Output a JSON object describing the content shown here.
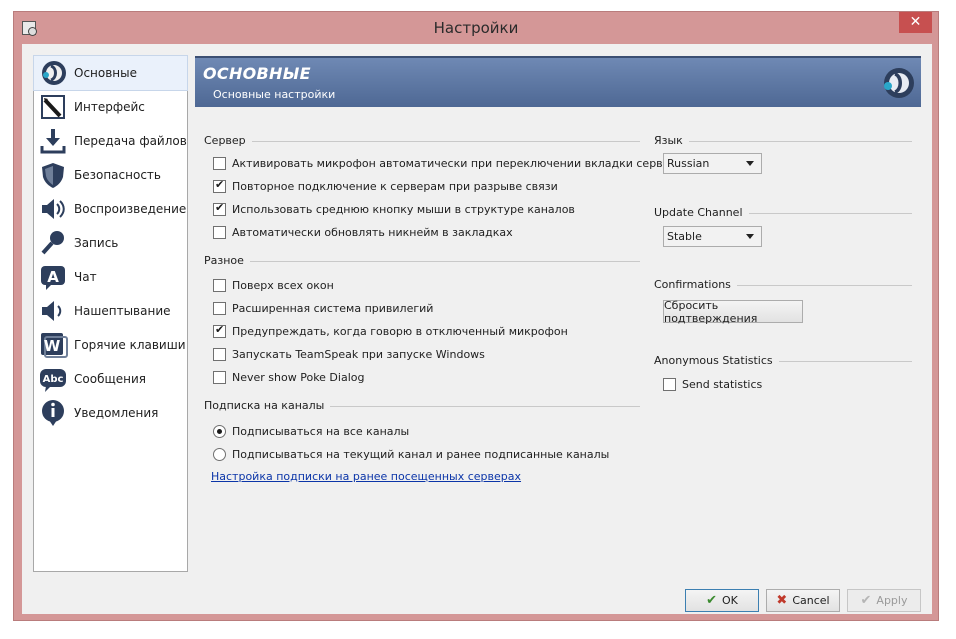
{
  "window": {
    "title": "Настройки",
    "close_glyph": "✕",
    "accent": "#d49797"
  },
  "sidebar": {
    "items": [
      {
        "label": "Основные",
        "icon": "teamspeak-logo-icon",
        "selected": true
      },
      {
        "label": "Интерфейс",
        "icon": "pen-icon"
      },
      {
        "label": "Передача файлов",
        "icon": "download-icon"
      },
      {
        "label": "Безопасность",
        "icon": "shield-icon"
      },
      {
        "label": "Воспроизведение",
        "icon": "speaker-icon"
      },
      {
        "label": "Запись",
        "icon": "microphone-icon"
      },
      {
        "label": "Чат",
        "icon": "chat-icon"
      },
      {
        "label": "Нашептывание",
        "icon": "whisper-icon"
      },
      {
        "label": "Горячие клавиши",
        "icon": "hotkey-icon"
      },
      {
        "label": "Сообщения",
        "icon": "messages-icon"
      },
      {
        "label": "Уведомления",
        "icon": "notification-icon"
      }
    ]
  },
  "banner": {
    "title": "ОСНОВНЫЕ",
    "subtitle": "Основные настройки",
    "color": "#5a74a0"
  },
  "server": {
    "title": "Сервер",
    "options": [
      {
        "label": "Активировать микрофон автоматически при переключении вкладки сервера",
        "checked": false
      },
      {
        "label": "Повторное подключение к серверам при разрыве связи",
        "checked": true
      },
      {
        "label": "Использовать среднюю кнопку мыши в структуре каналов",
        "checked": true
      },
      {
        "label": "Автоматически обновлять никнейм в закладках",
        "checked": false
      }
    ]
  },
  "misc": {
    "title": "Разное",
    "options": [
      {
        "label": "Поверх всех окон",
        "checked": false
      },
      {
        "label": "Расширенная система привилегий",
        "checked": false
      },
      {
        "label": "Предупреждать, когда говорю в отключенный микрофон",
        "checked": true
      },
      {
        "label": "Запускать TeamSpeak при запуске Windows",
        "checked": false
      },
      {
        "label": "Never show Poke Dialog",
        "checked": false
      }
    ]
  },
  "subscription": {
    "title": "Подписка на каналы",
    "options": [
      {
        "label": "Подписываться на все каналы",
        "selected": true
      },
      {
        "label": "Подписываться на текущий канал и ранее подписанные каналы",
        "selected": false
      }
    ],
    "link": "Настройка подписки на ранее посещенных серверах"
  },
  "language": {
    "title": "Язык",
    "value": "Russian"
  },
  "update_channel": {
    "title": "Update Channel",
    "value": "Stable"
  },
  "confirmations": {
    "title": "Confirmations",
    "button": "Сбросить подтверждения"
  },
  "stats": {
    "title": "Anonymous Statistics",
    "option": "Send statistics",
    "checked": false
  },
  "footer": {
    "ok": "OK",
    "cancel": "Cancel",
    "apply": "Apply"
  }
}
